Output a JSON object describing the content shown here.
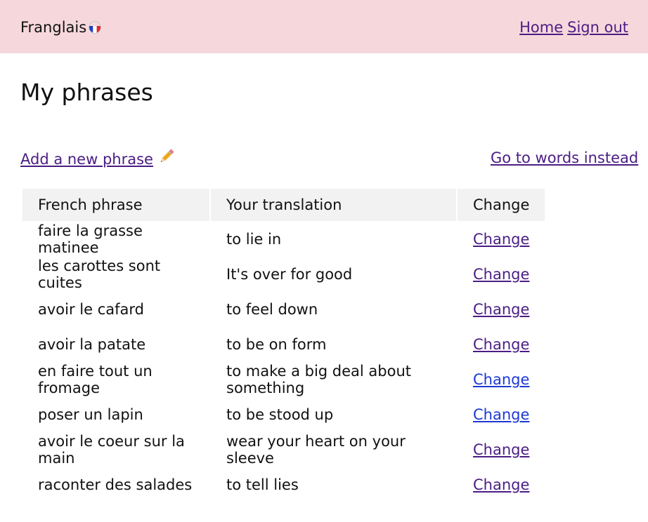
{
  "header": {
    "brand": "Franglais",
    "brand_flag_icon": "france-flag-icon",
    "nav": [
      {
        "label": "Home"
      },
      {
        "label": "Sign out"
      }
    ]
  },
  "page": {
    "title": "My phrases",
    "add_label": "Add a new phrase",
    "add_icon": "pencil-icon",
    "switch_label": "Go to words instead"
  },
  "table": {
    "headers": [
      "French phrase",
      "Your translation",
      "Change"
    ],
    "rows": [
      {
        "french": "faire la grasse matinee",
        "translation": "to lie in",
        "action": "Change"
      },
      {
        "french": "les carottes sont cuites",
        "translation": "It's over for good",
        "action": "Change"
      },
      {
        "french": "avoir le cafard",
        "translation": "to feel down",
        "action": "Change"
      },
      {
        "french": "avoir la patate",
        "translation": "to be on form",
        "action": "Change"
      },
      {
        "french": "en faire tout un fromage",
        "translation": "to make a big deal about something",
        "action": "Change"
      },
      {
        "french": "poser un lapin",
        "translation": "to be stood up",
        "action": "Change"
      },
      {
        "french": "avoir le coeur sur la main",
        "translation": "wear your heart on your sleeve",
        "action": "Change"
      },
      {
        "french": "raconter des salades",
        "translation": "to tell lies",
        "action": "Change"
      }
    ]
  },
  "colors": {
    "header_bg": "#f6d8dc",
    "visited_link": "#4b1d84",
    "unvisited_link": "#1d38d6",
    "table_header_bg": "#f2f2f2"
  }
}
